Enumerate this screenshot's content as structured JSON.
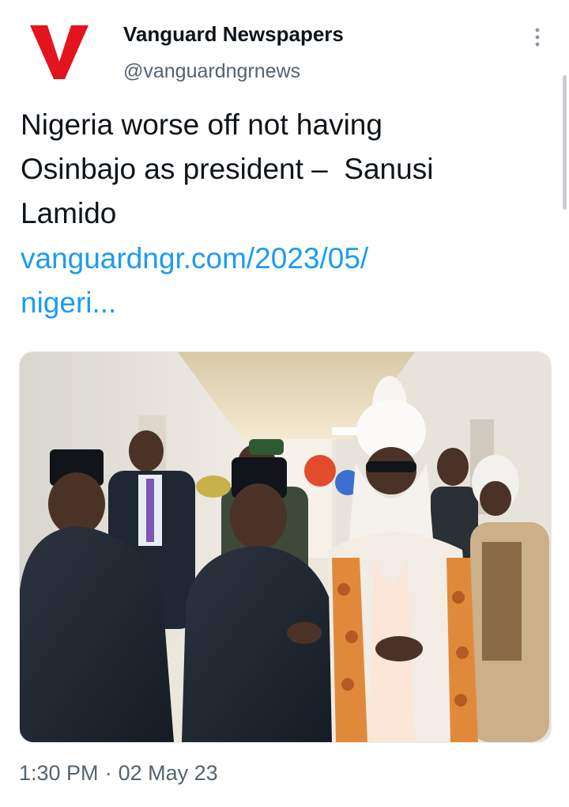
{
  "colors": {
    "brand_red": "#e3141d",
    "link_blue": "#1d9bf0",
    "muted_text": "#536471"
  },
  "author": {
    "logo_letter": "V",
    "name": "Vanguard Newspapers",
    "handle": "@vanguardngrnews"
  },
  "menu": {
    "icon": "more-vertical-icon"
  },
  "tweet": {
    "text_lines": [
      "Nigeria worse off not having",
      "Osinbajo as president –  Sanusi",
      "Lamido"
    ],
    "link_lines": [
      "vanguardngr.com/2023/05/",
      "nigeri..."
    ]
  },
  "meta": {
    "time": "1:30 PM",
    "separator": "·",
    "date": "02 May 23"
  }
}
